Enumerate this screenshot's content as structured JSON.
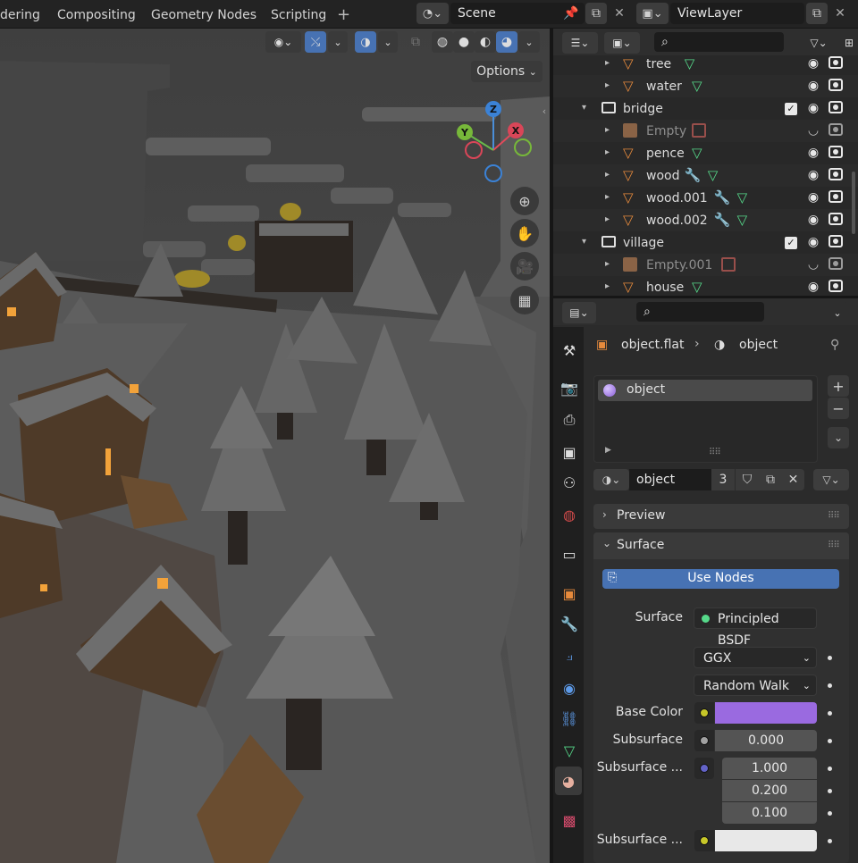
{
  "workspace_tabs": [
    "dering",
    "Compositing",
    "Geometry Nodes",
    "Scripting"
  ],
  "add_tab_label": "+",
  "scene": {
    "name": "Scene"
  },
  "view_layer": {
    "name": "ViewLayer"
  },
  "viewport": {
    "options_label": "Options",
    "gizmo_axes": {
      "x": "X",
      "y": "Y",
      "z": "Z"
    }
  },
  "outliner": {
    "rows": [
      {
        "label": "tree",
        "indent": 2,
        "type": "mesh",
        "expand": "▸",
        "mods": [
          "mesh-data"
        ],
        "visible": true
      },
      {
        "label": "water",
        "indent": 2,
        "type": "mesh",
        "expand": "▸",
        "mods": [
          "mesh-data"
        ],
        "visible": true
      },
      {
        "label": "bridge",
        "indent": 1,
        "type": "collection",
        "expand": "▾",
        "checked": true,
        "visible": true
      },
      {
        "label": "Empty",
        "indent": 2,
        "type": "empty",
        "expand": "▸",
        "mods": [
          "image"
        ],
        "disabled": true
      },
      {
        "label": "pence",
        "indent": 2,
        "type": "mesh",
        "expand": "▸",
        "mods": [
          "mesh-data"
        ],
        "visible": true
      },
      {
        "label": "wood",
        "indent": 2,
        "type": "mesh",
        "expand": "▸",
        "mods": [
          "wrench",
          "mesh-data"
        ],
        "visible": true
      },
      {
        "label": "wood.001",
        "indent": 2,
        "type": "mesh",
        "expand": "▸",
        "mods": [
          "wrench",
          "mesh-data"
        ],
        "visible": true
      },
      {
        "label": "wood.002",
        "indent": 2,
        "type": "mesh",
        "expand": "▸",
        "mods": [
          "wrench",
          "mesh-data"
        ],
        "visible": true
      },
      {
        "label": "village",
        "indent": 1,
        "type": "collection",
        "expand": "▾",
        "checked": true,
        "visible": true
      },
      {
        "label": "Empty.001",
        "indent": 2,
        "type": "empty",
        "expand": "▸",
        "mods": [
          "image"
        ],
        "disabled": true
      },
      {
        "label": "house",
        "indent": 2,
        "type": "mesh",
        "expand": "▸",
        "mods": [
          "mesh-data"
        ],
        "visible": true
      }
    ]
  },
  "properties": {
    "breadcrumb": {
      "object": "object.flat",
      "material": "object"
    },
    "slot_name": "object",
    "material_name": "object",
    "user_count": "3",
    "preview_label": "Preview",
    "surface_label": "Surface",
    "use_nodes_label": "Use Nodes",
    "surface_row": {
      "label": "Surface",
      "value": "Principled BSDF"
    },
    "distribution": "GGX",
    "subsurface_method": "Random Walk",
    "base_color": {
      "label": "Base Color",
      "color": "#9a6ae0"
    },
    "subsurface": {
      "label": "Subsurface",
      "value": "0.000"
    },
    "subsurface_radius": {
      "label": "Subsurface ...",
      "values": [
        "1.000",
        "0.200",
        "0.100"
      ]
    },
    "subsurface_color": {
      "label": "Subsurface ...",
      "color": "#e8e8e8"
    }
  },
  "colors": {
    "accent": "#4772b3",
    "object_orange": "#e68a3c",
    "mesh_green": "#56d98a"
  }
}
